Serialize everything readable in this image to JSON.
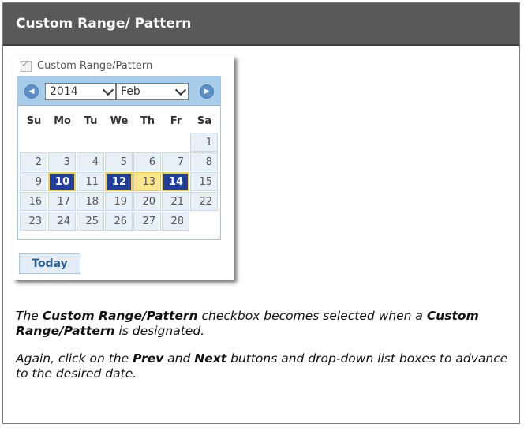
{
  "header": {
    "title": "Custom Range/ Pattern"
  },
  "calendar": {
    "checkbox_label": "Custom Range/Pattern",
    "year": "2014",
    "month": "Feb",
    "dow": [
      "Su",
      "Mo",
      "Tu",
      "We",
      "Th",
      "Fr",
      "Sa"
    ],
    "weeks": [
      [
        "",
        "",
        "",
        "",
        "",
        "",
        "1"
      ],
      [
        "2",
        "3",
        "4",
        "5",
        "6",
        "7",
        "8"
      ],
      [
        "9",
        "10",
        "11",
        "12",
        "13",
        "14",
        "15"
      ],
      [
        "16",
        "17",
        "18",
        "19",
        "20",
        "21",
        "22"
      ],
      [
        "23",
        "24",
        "25",
        "26",
        "27",
        "28",
        ""
      ]
    ],
    "today_label": "Today"
  },
  "description": {
    "p1": {
      "t1": "The ",
      "b1": "Custom Range/Pattern",
      "t2": " checkbox becomes selected when a ",
      "b2": "Custom Range/Pattern",
      "t3": " is designated."
    },
    "p2": {
      "t1": " Again, click on the ",
      "b1": "Prev",
      "t2": " and ",
      "b2": "Next",
      "t3": " buttons and drop-down list boxes to advance to the desired date."
    }
  },
  "icons": {
    "prev": "chevron-left-icon",
    "next": "chevron-right-icon",
    "check": "check-icon"
  },
  "colors": {
    "header_bg": "#595959",
    "selected_day": "#1f3f9f",
    "range_day": "#fce68d",
    "cal_header": "#a7cdea"
  }
}
